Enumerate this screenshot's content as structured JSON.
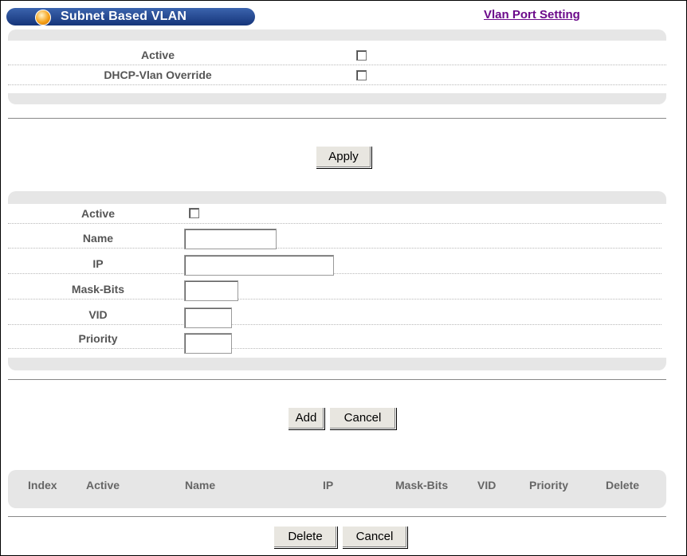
{
  "title": "Subnet Based VLAN",
  "port_link": "Vlan Port Setting",
  "global": {
    "active_label": "Active",
    "dhcp_label": "DHCP-Vlan Override"
  },
  "apply_label": "Apply",
  "entry": {
    "active_label": "Active",
    "name_label": "Name",
    "ip_label": "IP",
    "mask_label": "Mask-Bits",
    "vid_label": "VID",
    "priority_label": "Priority",
    "name_value": "",
    "ip_value": "",
    "mask_value": "",
    "vid_value": "",
    "priority_value": ""
  },
  "add_label": "Add",
  "cancel_label": "Cancel",
  "table": {
    "headers": [
      "Index",
      "Active",
      "Name",
      "IP",
      "Mask-Bits",
      "VID",
      "Priority",
      "Delete"
    ]
  },
  "delete_label": "Delete",
  "cancel2_label": "Cancel"
}
